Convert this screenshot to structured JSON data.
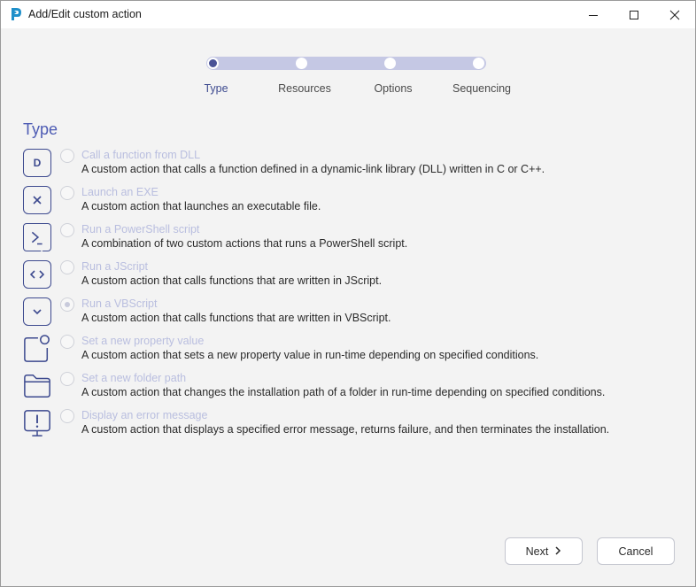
{
  "window": {
    "title": "Add/Edit custom action",
    "icons": [
      "app-logo-icon",
      "minimize-icon",
      "maximize-icon",
      "close-icon"
    ]
  },
  "stepper": {
    "steps": [
      {
        "label": "Type",
        "active": true
      },
      {
        "label": "Resources",
        "active": false
      },
      {
        "label": "Options",
        "active": false
      },
      {
        "label": "Sequencing",
        "active": false
      }
    ]
  },
  "section": {
    "title": "Type"
  },
  "options": [
    {
      "icon": "dll-icon",
      "icon_text": "D",
      "title": "Call a function from DLL",
      "desc": "A custom action that calls a function defined in a dynamic-link library (DLL) written in C or C++.",
      "checked": false
    },
    {
      "icon": "exe-icon",
      "icon_text": "×",
      "title": "Launch an EXE",
      "desc": "A custom action that launches an executable file.",
      "checked": false
    },
    {
      "icon": "powershell-icon",
      "icon_text": "",
      "title": "Run a PowerShell script",
      "desc": "A combination of two custom actions that runs a PowerShell script.",
      "checked": false
    },
    {
      "icon": "jscript-icon",
      "icon_text": "<>",
      "title": "Run a JScript",
      "desc": "A custom action that calls functions that are written in JScript.",
      "checked": false
    },
    {
      "icon": "vbscript-icon",
      "icon_text": "",
      "title": "Run a VBScript",
      "desc": "A custom action that calls functions that are written in VBScript.",
      "checked": true
    },
    {
      "icon": "property-icon",
      "icon_text": "",
      "title": "Set a new property value",
      "desc": "A custom action that sets a new property value in run-time depending on specified conditions.",
      "checked": false
    },
    {
      "icon": "folder-icon",
      "icon_text": "",
      "title": "Set a new folder path",
      "desc": "A custom action that changes the installation path of a folder in run-time depending on specified conditions.",
      "checked": false
    },
    {
      "icon": "error-message-icon",
      "icon_text": "",
      "title": "Display an error message",
      "desc": "A custom action that displays a specified error message, returns failure, and then terminates the installation.",
      "checked": false
    }
  ],
  "buttons": {
    "next": "Next",
    "cancel": "Cancel"
  },
  "colors": {
    "accent": "#3d4a8f",
    "track": "#c5c8e4",
    "section_title": "#4e5cb4",
    "disabled_text": "#b9bedf"
  }
}
